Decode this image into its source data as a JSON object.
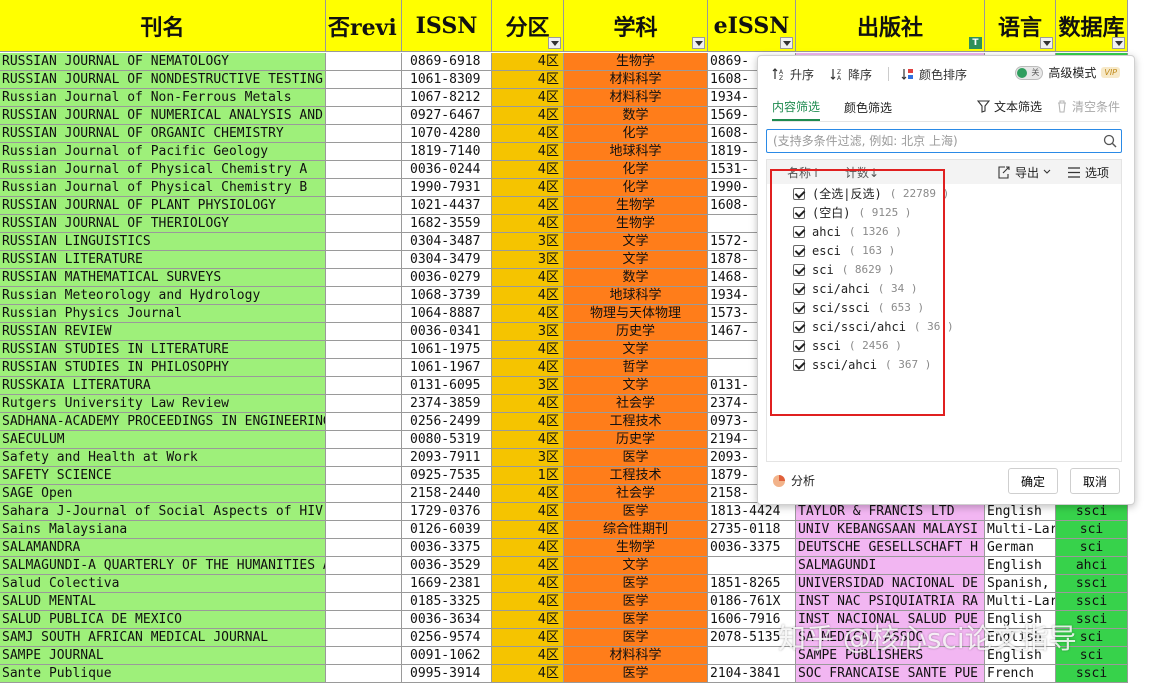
{
  "columns": [
    {
      "label": "刊名"
    },
    {
      "label": "否revi"
    },
    {
      "label": "ISSN"
    },
    {
      "label": "分区"
    },
    {
      "label": "学科"
    },
    {
      "label": "eISSN"
    },
    {
      "label": "出版社"
    },
    {
      "label": "语言"
    },
    {
      "label": "数据库"
    }
  ],
  "rows": [
    {
      "name": "RUSSIAN JOURNAL OF NEMATOLOGY",
      "issn": "0869-6918",
      "zone": "4区",
      "subject": "生物学",
      "eissn": "0869-",
      "publisher": "",
      "language": "",
      "db": ""
    },
    {
      "name": "RUSSIAN JOURNAL OF NONDESTRUCTIVE TESTING",
      "issn": "1061-8309",
      "zone": "4区",
      "subject": "材料科学",
      "eissn": "1608-",
      "publisher": "",
      "language": "",
      "db": ""
    },
    {
      "name": "Russian Journal of Non-Ferrous Metals",
      "issn": "1067-8212",
      "zone": "4区",
      "subject": "材料科学",
      "eissn": "1934-",
      "publisher": "",
      "language": "",
      "db": ""
    },
    {
      "name": "RUSSIAN JOURNAL OF NUMERICAL ANALYSIS AND MATHEMA",
      "issn": "0927-6467",
      "zone": "4区",
      "subject": "数学",
      "eissn": "1569-",
      "publisher": "",
      "language": "",
      "db": ""
    },
    {
      "name": "RUSSIAN JOURNAL OF ORGANIC CHEMISTRY",
      "issn": "1070-4280",
      "zone": "4区",
      "subject": "化学",
      "eissn": "1608-",
      "publisher": "",
      "language": "",
      "db": ""
    },
    {
      "name": "Russian Journal of Pacific Geology",
      "issn": "1819-7140",
      "zone": "4区",
      "subject": "地球科学",
      "eissn": "1819-",
      "publisher": "",
      "language": "",
      "db": ""
    },
    {
      "name": "Russian Journal of Physical Chemistry A",
      "issn": "0036-0244",
      "zone": "4区",
      "subject": "化学",
      "eissn": "1531-",
      "publisher": "",
      "language": "",
      "db": ""
    },
    {
      "name": "Russian Journal of Physical Chemistry B",
      "issn": "1990-7931",
      "zone": "4区",
      "subject": "化学",
      "eissn": "1990-",
      "publisher": "",
      "language": "",
      "db": ""
    },
    {
      "name": "RUSSIAN JOURNAL OF PLANT PHYSIOLOGY",
      "issn": "1021-4437",
      "zone": "4区",
      "subject": "生物学",
      "eissn": "1608-",
      "publisher": "",
      "language": "",
      "db": ""
    },
    {
      "name": "RUSSIAN JOURNAL OF THERIOLOGY",
      "issn": "1682-3559",
      "zone": "4区",
      "subject": "生物学",
      "eissn": "",
      "publisher": "",
      "language": "",
      "db": ""
    },
    {
      "name": "RUSSIAN LINGUISTICS",
      "issn": "0304-3487",
      "zone": "3区",
      "subject": "文学",
      "eissn": "1572-",
      "publisher": "",
      "language": "",
      "db": ""
    },
    {
      "name": "RUSSIAN LITERATURE",
      "issn": "0304-3479",
      "zone": "3区",
      "subject": "文学",
      "eissn": "1878-",
      "publisher": "",
      "language": "",
      "db": ""
    },
    {
      "name": "RUSSIAN MATHEMATICAL SURVEYS",
      "issn": "0036-0279",
      "zone": "4区",
      "subject": "数学",
      "eissn": "1468-",
      "publisher": "",
      "language": "",
      "db": ""
    },
    {
      "name": "Russian Meteorology and Hydrology",
      "issn": "1068-3739",
      "zone": "4区",
      "subject": "地球科学",
      "eissn": "1934-",
      "publisher": "",
      "language": "",
      "db": ""
    },
    {
      "name": "Russian Physics Journal",
      "issn": "1064-8887",
      "zone": "4区",
      "subject": "物理与天体物理",
      "eissn": "1573-",
      "publisher": "",
      "language": "",
      "db": ""
    },
    {
      "name": "RUSSIAN REVIEW",
      "issn": "0036-0341",
      "zone": "3区",
      "subject": "历史学",
      "eissn": "1467-",
      "publisher": "",
      "language": "",
      "db": ""
    },
    {
      "name": "RUSSIAN STUDIES IN LITERATURE",
      "issn": "1061-1975",
      "zone": "4区",
      "subject": "文学",
      "eissn": "",
      "publisher": "",
      "language": "",
      "db": ""
    },
    {
      "name": "RUSSIAN STUDIES IN PHILOSOPHY",
      "issn": "1061-1967",
      "zone": "4区",
      "subject": "哲学",
      "eissn": "",
      "publisher": "",
      "language": "",
      "db": ""
    },
    {
      "name": "RUSSKAIA LITERATURA",
      "issn": "0131-6095",
      "zone": "3区",
      "subject": "文学",
      "eissn": "0131-",
      "publisher": "",
      "language": "",
      "db": ""
    },
    {
      "name": "Rutgers University Law Review",
      "issn": "2374-3859",
      "zone": "4区",
      "subject": "社会学",
      "eissn": "2374-",
      "publisher": "",
      "language": "",
      "db": ""
    },
    {
      "name": "SADHANA-ACADEMY PROCEEDINGS IN ENGINEERING SCIENC",
      "issn": "0256-2499",
      "zone": "4区",
      "subject": "工程技术",
      "eissn": "0973-",
      "publisher": "",
      "language": "",
      "db": ""
    },
    {
      "name": "SAECULUM",
      "issn": "0080-5319",
      "zone": "4区",
      "subject": "历史学",
      "eissn": "2194-",
      "publisher": "",
      "language": "",
      "db": ""
    },
    {
      "name": "Safety and Health at Work",
      "issn": "2093-7911",
      "zone": "3区",
      "subject": "医学",
      "eissn": "2093-",
      "publisher": "",
      "language": "",
      "db": ""
    },
    {
      "name": "SAFETY SCIENCE",
      "issn": "0925-7535",
      "zone": "1区",
      "subject": "工程技术",
      "eissn": "1879-",
      "publisher": "",
      "language": "",
      "db": ""
    },
    {
      "name": "SAGE Open",
      "issn": "2158-2440",
      "zone": "4区",
      "subject": "社会学",
      "eissn": "2158-",
      "publisher": "",
      "language": "",
      "db": ""
    },
    {
      "name": "Sahara J-Journal of Social Aspects of HIV-AIDS",
      "issn": "1729-0376",
      "zone": "4区",
      "subject": "医学",
      "eissn": "1813-4424",
      "publisher": "TAYLOR & FRANCIS LTD",
      "language": "English",
      "db": "ssci"
    },
    {
      "name": "Sains Malaysiana",
      "issn": "0126-6039",
      "zone": "4区",
      "subject": "综合性期刊",
      "eissn": "2735-0118",
      "publisher": "UNIV KEBANGSAAN MALAYSI",
      "language": "Multi-Lar",
      "db": "sci"
    },
    {
      "name": "SALAMANDRA",
      "issn": "0036-3375",
      "zone": "4区",
      "subject": "生物学",
      "eissn": "0036-3375",
      "publisher": "DEUTSCHE GESELLSCHAFT H",
      "language": "German",
      "db": "sci"
    },
    {
      "name": "SALMAGUNDI-A QUARTERLY OF THE HUMANITIES AND SOCI",
      "issn": "0036-3529",
      "zone": "4区",
      "subject": "文学",
      "eissn": "",
      "publisher": "SALMAGUNDI",
      "language": "English",
      "db": "ahci"
    },
    {
      "name": "Salud Colectiva",
      "issn": "1669-2381",
      "zone": "4区",
      "subject": "医学",
      "eissn": "1851-8265",
      "publisher": "UNIVERSIDAD NACIONAL DE",
      "language": "Spanish,",
      "db": "ssci"
    },
    {
      "name": "SALUD MENTAL",
      "issn": "0185-3325",
      "zone": "4区",
      "subject": "医学",
      "eissn": "0186-761X",
      "publisher": "INST NAC PSIQUIATRIA RA",
      "language": "Multi-Lar",
      "db": "ssci"
    },
    {
      "name": "SALUD PUBLICA DE MEXICO",
      "issn": "0036-3634",
      "zone": "4区",
      "subject": "医学",
      "eissn": "1606-7916",
      "publisher": "INST NACIONAL SALUD PUE",
      "language": "English",
      "db": "ssci"
    },
    {
      "name": "SAMJ SOUTH AFRICAN MEDICAL JOURNAL",
      "issn": "0256-9574",
      "zone": "4区",
      "subject": "医学",
      "eissn": "2078-5135",
      "publisher": "SA MEDICAL ASSOC",
      "language": "English",
      "db": "sci"
    },
    {
      "name": "SAMPE JOURNAL",
      "issn": "0091-1062",
      "zone": "4区",
      "subject": "材料科学",
      "eissn": "",
      "publisher": "SAMPE PUBLISHERS",
      "language": "English",
      "db": "sci"
    },
    {
      "name": "Sante Publique",
      "issn": "0995-3914",
      "zone": "4区",
      "subject": "医学",
      "eissn": "2104-3841",
      "publisher": "SOC FRANCAISE SANTE PUE",
      "language": "French",
      "db": "ssci"
    }
  ],
  "filter_panel": {
    "sort_asc": "升序",
    "sort_desc": "降序",
    "color_sort": "颜色排序",
    "toggle_text": "关",
    "advanced_mode": "高级模式",
    "vip_badge": "VIP",
    "tab_content": "内容筛选",
    "tab_color": "颜色筛选",
    "text_filter": "文本筛选",
    "clear_conditions": "清空条件",
    "search_placeholder": "(支持多条件过滤, 例如: 北京 上海)",
    "sort_by_name": "名称↑",
    "sort_by_count": "计数↓",
    "export": "导出",
    "options": "选项",
    "items": [
      {
        "label": "(全选|反选)",
        "count": "( 22789 )"
      },
      {
        "label": "(空白)",
        "count": "( 9125 )"
      },
      {
        "label": "ahci",
        "count": "( 1326 )"
      },
      {
        "label": "esci",
        "count": "( 163 )"
      },
      {
        "label": "sci",
        "count": "( 8629 )"
      },
      {
        "label": "sci/ahci",
        "count": "( 34 )"
      },
      {
        "label": "sci/ssci",
        "count": "( 653 )"
      },
      {
        "label": "sci/ssci/ahci",
        "count": "( 36 )"
      },
      {
        "label": "ssci",
        "count": "( 2456 )"
      },
      {
        "label": "ssci/ahci",
        "count": "( 367 )"
      }
    ],
    "analyze": "分析",
    "ok": "确定",
    "cancel": "取消"
  },
  "watermark": "知乎 @核心sci论文指导",
  "colors": {
    "header": "#ffff00",
    "name_col": "#9ef07a",
    "zone_col": "#f5c400",
    "subject_col": "#ff7d1a",
    "publisher_col": "#f2b6f2",
    "db_col": "#37d24b",
    "highlight_box": "#e02020",
    "accent": "#1e8b4f"
  }
}
